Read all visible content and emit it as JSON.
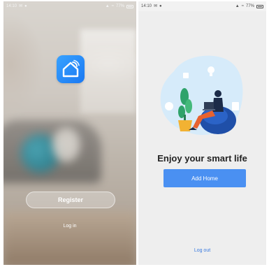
{
  "left_screen": {
    "status_bar": {
      "time": "14:10",
      "left_icons": [
        "message-icon",
        "notification-icon"
      ],
      "right_text": "77%",
      "right_icons": [
        "signal-icon",
        "wifi-icon",
        "battery-icon"
      ]
    },
    "app_icon": "smart-home-icon",
    "register_label": "Register",
    "login_label": "Log in"
  },
  "right_screen": {
    "status_bar": {
      "time": "14:10",
      "left_icons": [
        "message-icon",
        "notification-icon"
      ],
      "right_text": "77%",
      "right_icons": [
        "signal-icon",
        "wifi-icon",
        "battery-icon"
      ]
    },
    "headline": "Enjoy your smart life",
    "add_home_label": "Add Home",
    "logout_label": "Log out"
  },
  "colors": {
    "accent_blue": "#4a90f2",
    "logo_blue": "#1a78f2",
    "headline_text": "#222222",
    "link_blue": "#3a7be0"
  }
}
